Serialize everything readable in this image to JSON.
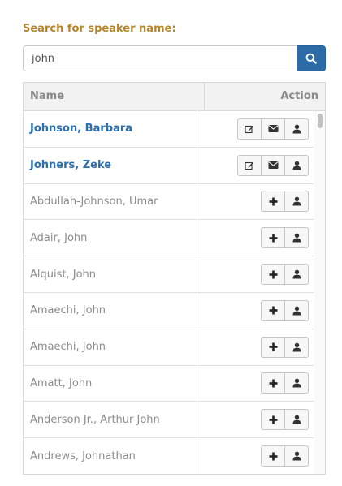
{
  "search": {
    "label": "Search for speaker name:",
    "value": "john",
    "placeholder": ""
  },
  "table": {
    "headers": {
      "name": "Name",
      "action": "Action"
    },
    "rows": [
      {
        "name": "Johnson, Barbara",
        "linked": true,
        "actions": [
          "edit-icon",
          "envelope-icon",
          "user-icon"
        ]
      },
      {
        "name": "Johners, Zeke",
        "linked": true,
        "actions": [
          "edit-icon",
          "envelope-icon",
          "user-icon"
        ]
      },
      {
        "name": "Abdullah-Johnson, Umar",
        "linked": false,
        "actions": [
          "plus-icon",
          "user-icon"
        ]
      },
      {
        "name": "Adair, John",
        "linked": false,
        "actions": [
          "plus-icon",
          "user-icon"
        ]
      },
      {
        "name": "Alquist, John",
        "linked": false,
        "actions": [
          "plus-icon",
          "user-icon"
        ]
      },
      {
        "name": "Amaechi, John",
        "linked": false,
        "actions": [
          "plus-icon",
          "user-icon"
        ]
      },
      {
        "name": "Amaechi, John",
        "linked": false,
        "actions": [
          "plus-icon",
          "user-icon"
        ]
      },
      {
        "name": "Amatt, John",
        "linked": false,
        "actions": [
          "plus-icon",
          "user-icon"
        ]
      },
      {
        "name": "Anderson Jr., Arthur John",
        "linked": false,
        "actions": [
          "plus-icon",
          "user-icon"
        ]
      },
      {
        "name": "Andrews, Johnathan",
        "linked": false,
        "actions": [
          "plus-icon",
          "user-icon"
        ]
      }
    ]
  },
  "colors": {
    "label": "#b5852a",
    "primary": "#2b6ca6",
    "link": "#2c6fae",
    "muted": "#8c8c8c"
  }
}
